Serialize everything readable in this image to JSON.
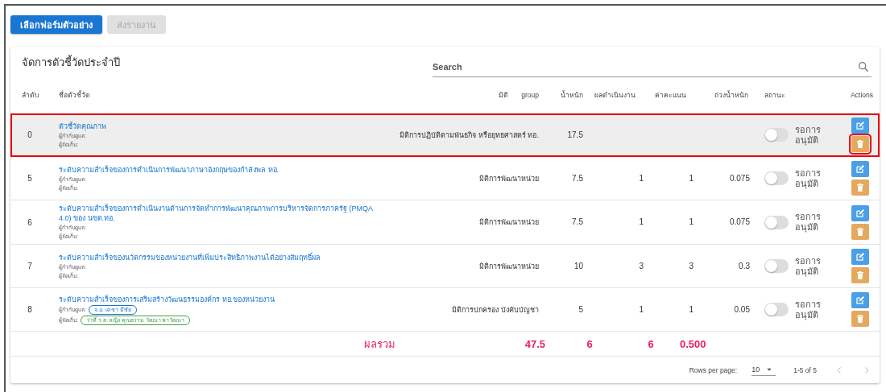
{
  "toolbar": {
    "buttons": [
      {
        "label": "เลือกฟอร์มตัวอย่าง",
        "disabled": false
      },
      {
        "label": "ส่งรายงาน",
        "disabled": true
      }
    ]
  },
  "card": {
    "title": "จัดการตัวชี้วัดประจำปี",
    "search": {
      "placeholder": "Search"
    }
  },
  "table": {
    "columns": [
      "ลำดับ",
      "ชื่อตัวชี้วัด",
      "มิติ group",
      "น้ำหนัก",
      "ผลดำเนินงาน",
      "ค่าคะแนน",
      "ถ่วงน้ำหนัก",
      "สถานะ",
      "Actions"
    ],
    "rows": [
      {
        "order": "0",
        "name": "ตัวชี้วัดคุณภาพ",
        "supervisor_label": "ผู้กำกับดูแล:",
        "collector_label": "ผู้จัดเก็บ:",
        "group": "มิติการปฏิบัติตามพันธกิจ หรือยุทธศาสตร์ ทอ.",
        "weight": "17.5",
        "result": "",
        "score": "",
        "weighted": "",
        "status_on": false,
        "status": "รอการอนุมัติ",
        "selected": true,
        "highlighted": true,
        "delete_highlighted": true
      },
      {
        "order": "5",
        "name": "ระดับความสำเร็จของการดำเนินการพัฒนาภาษาอังกฤษของกำลังพล ทอ.",
        "supervisor_label": "ผู้กำกับดูแล:",
        "collector_label": "ผู้จัดเก็บ:",
        "group": "มิติการพัฒนาหน่วย",
        "weight": "7.5",
        "result": "1",
        "score": "1",
        "weighted": "0.075",
        "status_on": false,
        "status": "รอการอนุมัติ",
        "selected": false,
        "highlighted": false,
        "delete_highlighted": false
      },
      {
        "order": "6",
        "name": "ระดับความสำเร็จของการดำเนินงานด้านการจัดทำการพัฒนาคุณภาพการบริหารจัดการภาครัฐ (PMQA 4.0) ของ นขต.ทอ.",
        "supervisor_label": "ผู้กำกับดูแล:",
        "collector_label": "ผู้จัดเก็บ:",
        "group": "มิติการพัฒนาหน่วย",
        "weight": "7.5",
        "result": "1",
        "score": "1",
        "weighted": "0.075",
        "status_on": false,
        "status": "รอการอนุมัติ",
        "selected": false,
        "highlighted": false,
        "delete_highlighted": false
      },
      {
        "order": "7",
        "name": "ระดับความสำเร็จของนวัตกรรมของหน่วยงานที่เพิ่มประสิทธิภาพงานได้อย่างสัมฤทธิ์ผล",
        "supervisor_label": "ผู้กำกับดูแล:",
        "collector_label": "ผู้จัดเก็บ:",
        "group": "มิติการพัฒนาหน่วย",
        "weight": "10",
        "result": "3",
        "score": "3",
        "weighted": "0.3",
        "status_on": false,
        "status": "รอการอนุมัติ",
        "selected": false,
        "highlighted": false,
        "delete_highlighted": false
      },
      {
        "order": "8",
        "name": "ระดับความสำเร็จของการเสริมสร้างวัฒนธรรมองค์กร ทอ.ของหน่วยงาน",
        "supervisor_label": "ผู้กำกับดูแล:",
        "supervisor_tag": "จ.อ. เดชา มีชัย",
        "collector_label": "ผู้จัดเก็บ:",
        "collector_tag": "ว่าที่ ร.ต.หญิง คุณธรรม วัฒนา พาวัฒนา",
        "group": "มิติการปกครอง บังคับบัญชา",
        "weight": "5",
        "result": "1",
        "score": "1",
        "weighted": "0.05",
        "status_on": false,
        "status": "รอการอนุมัติ",
        "selected": false,
        "highlighted": false,
        "delete_highlighted": false
      }
    ],
    "totals": {
      "label": "ผลรวม",
      "weight": "47.5",
      "result": "6",
      "score": "6",
      "weighted": "0.500"
    }
  },
  "footer": {
    "rows_per_page_label": "Rows per page:",
    "rows_per_page": "10",
    "range": "1-5 of 5"
  }
}
